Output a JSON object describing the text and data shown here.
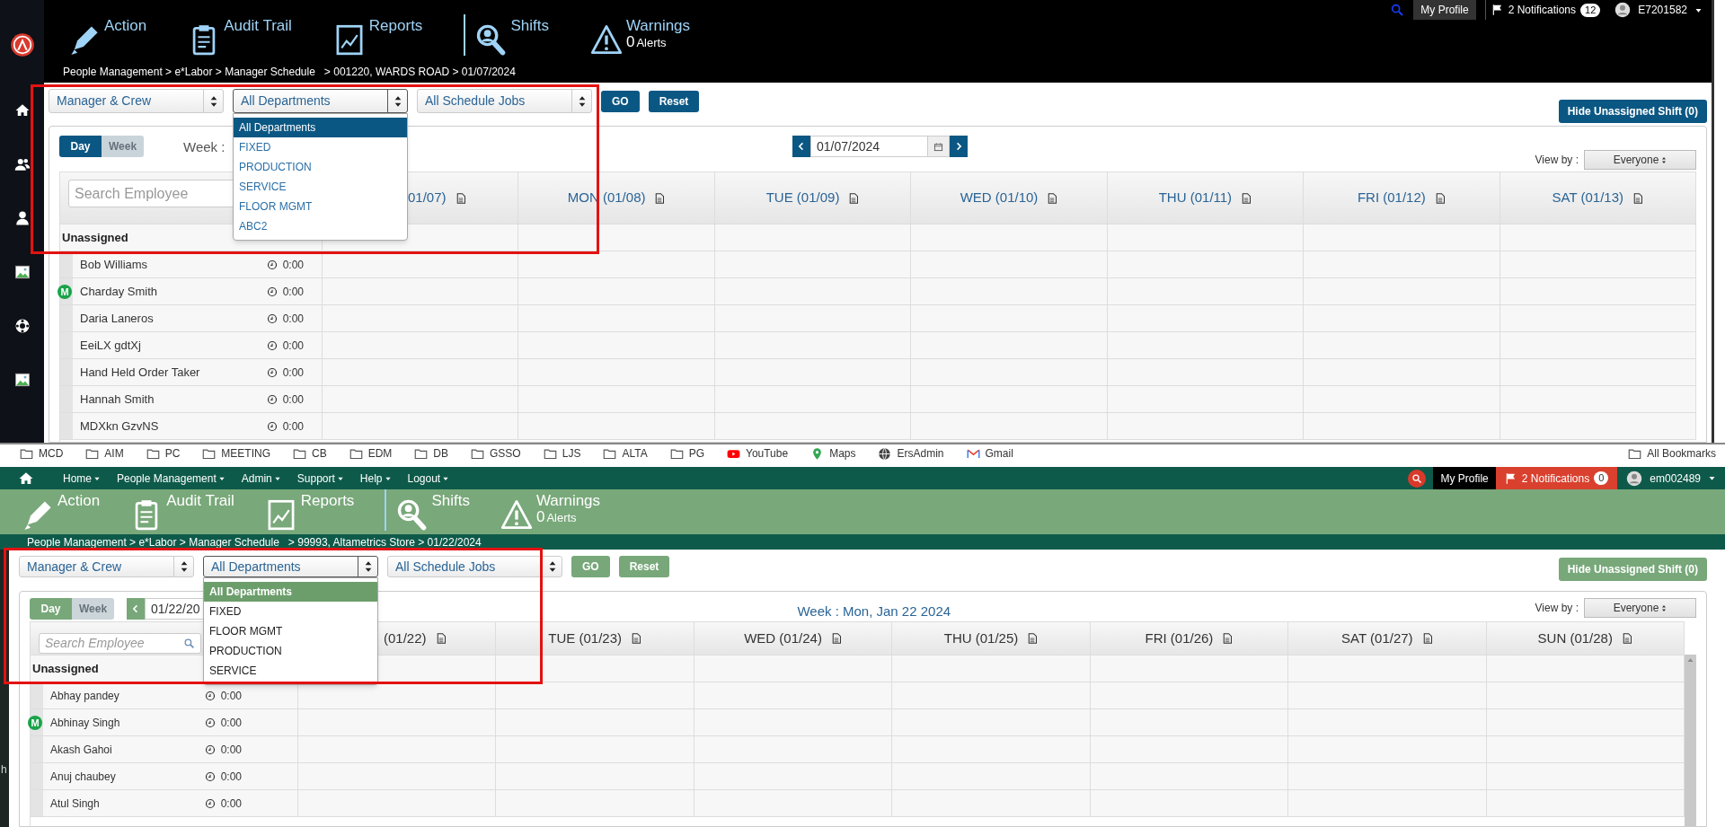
{
  "top_window": {
    "kind": "dark",
    "sidebar": [
      {
        "kind": "logo"
      },
      {
        "kind": "home"
      },
      {
        "kind": "users"
      },
      {
        "kind": "user"
      },
      {
        "kind": "image"
      },
      {
        "kind": "lifebuoy"
      },
      {
        "kind": "image"
      }
    ],
    "account": {
      "profile": "My Profile",
      "notifications": "2 Notifications",
      "notification_count": "12",
      "user": "E7201582"
    },
    "toolbar": [
      {
        "kind": "pencil",
        "label": "Action"
      },
      {
        "kind": "clipboard",
        "label": "Audit Trail"
      },
      {
        "kind": "report",
        "label": "Reports"
      },
      {
        "kind": "search-person",
        "label": "Shifts",
        "divider": true
      },
      {
        "kind": "warning",
        "label": "Warnings",
        "count": "0",
        "count_label": "Alerts"
      }
    ],
    "breadcrumb": "People Management > e*Labor > Manager Schedule   > 001220, WARDS ROAD > 01/07/2024",
    "filters": [
      {
        "value": "Manager & Crew",
        "expanded": false
      },
      {
        "value": "All Departments",
        "expanded": true,
        "options": [
          {
            "label": "All Departments",
            "selected": true
          },
          {
            "label": "FIXED",
            "selected": false
          },
          {
            "label": "PRODUCTION",
            "selected": false
          },
          {
            "label": "SERVICE",
            "selected": false
          },
          {
            "label": "FLOOR MGMT",
            "selected": false
          },
          {
            "label": "ABC2",
            "selected": false
          }
        ]
      },
      {
        "value": "All Schedule Jobs",
        "expanded": false
      }
    ],
    "actions": [
      "GO",
      "Reset"
    ],
    "hide_button": "Hide Unassigned Shift (0)",
    "view_modes": [
      {
        "label": "Day",
        "selected": true
      },
      {
        "label": "Week",
        "selected": false
      }
    ],
    "week_label": "Week :",
    "date_nav": {
      "kind": "center",
      "value": "01/07/2024"
    },
    "view_by": {
      "label": "View by :",
      "value": "Everyone"
    },
    "search_placeholder": "Search Employee",
    "days": [
      "01/07)",
      "MON (01/08)",
      "TUE (01/09)",
      "WED (01/10)",
      "THU (01/11)",
      "FRI (01/12)",
      "SAT (01/13)"
    ],
    "unassigned": "Unassigned",
    "employees": [
      {
        "name": "Bob Williams",
        "hours": "0:00"
      },
      {
        "name": "Charday Smith",
        "hours": "0:00",
        "badge": "M"
      },
      {
        "name": "Daria Laneros",
        "hours": "0:00"
      },
      {
        "name": "EeiLX gdtXj",
        "hours": "0:00"
      },
      {
        "name": "Hand Held Order Taker",
        "hours": "0:00"
      },
      {
        "name": "Hannah Smith",
        "hours": "0:00"
      },
      {
        "name": "MDXkn GzvNS",
        "hours": "0:00"
      }
    ]
  },
  "bottom_window": {
    "kind": "green",
    "bookmarks": [
      {
        "kind": "folder",
        "label": "MCD"
      },
      {
        "kind": "folder",
        "label": "AIM"
      },
      {
        "kind": "folder",
        "label": "PC"
      },
      {
        "kind": "folder",
        "label": "MEETING"
      },
      {
        "kind": "folder",
        "label": "CB"
      },
      {
        "kind": "folder",
        "label": "EDM"
      },
      {
        "kind": "folder",
        "label": "DB"
      },
      {
        "kind": "folder",
        "label": "GSSO"
      },
      {
        "kind": "folder",
        "label": "LJS"
      },
      {
        "kind": "folder",
        "label": "ALTA"
      },
      {
        "kind": "folder",
        "label": "PG"
      },
      {
        "kind": "video",
        "label": "YouTube"
      },
      {
        "kind": "pin",
        "label": "Maps"
      },
      {
        "kind": "globe",
        "label": "ErsAdmin"
      },
      {
        "kind": "mail",
        "label": "Gmail"
      }
    ],
    "all_bookmarks": "All Bookmarks",
    "menu": [
      "Home",
      "People Management",
      "Admin",
      "Support",
      "Help",
      "Logout"
    ],
    "account": {
      "profile": "My Profile",
      "notifications": "2 Notifications",
      "notification_count": "0",
      "user": "em002489"
    },
    "toolbar": [
      {
        "kind": "pencil",
        "label": "Action"
      },
      {
        "kind": "clipboard",
        "label": "Audit Trail"
      },
      {
        "kind": "report",
        "label": "Reports"
      },
      {
        "kind": "search-person",
        "label": "Shifts",
        "divider": true
      },
      {
        "kind": "warning",
        "label": "Warnings",
        "count": "0",
        "count_label": "Alerts"
      }
    ],
    "breadcrumb": "People Management > e*Labor > Manager Schedule   > 99993, Altametrics Store > 01/22/2024",
    "filters": [
      {
        "value": "Manager & Crew",
        "expanded": false
      },
      {
        "value": "All Departments",
        "expanded": true,
        "options": [
          {
            "label": "All Departments",
            "selected": true
          },
          {
            "label": "FIXED",
            "selected": false
          },
          {
            "label": "FLOOR MGMT",
            "selected": false
          },
          {
            "label": "PRODUCTION",
            "selected": false
          },
          {
            "label": "SERVICE",
            "selected": false
          }
        ]
      },
      {
        "value": "All Schedule Jobs",
        "expanded": false
      }
    ],
    "actions": [
      "GO",
      "Reset"
    ],
    "hide_button": "Hide Unassigned Shift (0)",
    "view_modes": [
      {
        "label": "Day",
        "selected": true
      },
      {
        "label": "Week",
        "selected": false
      }
    ],
    "week_label": "Week : Mon, Jan 22 2024",
    "date_nav": {
      "kind": "left",
      "value": "01/22/20"
    },
    "view_by": {
      "label": "View by :",
      "value": "Everyone"
    },
    "search_placeholder": "Search Employee",
    "days": [
      "(01/22)",
      "TUE (01/23)",
      "WED (01/24)",
      "THU (01/25)",
      "FRI (01/26)",
      "SAT (01/27)",
      "SUN (01/28)"
    ],
    "unassigned": "Unassigned",
    "employees": [
      {
        "name": "Abhay pandey",
        "hours": "0:00"
      },
      {
        "name": "Abhinay Singh",
        "hours": "0:00",
        "badge": "M"
      },
      {
        "name": "Akash Gahoi",
        "hours": "0:00"
      },
      {
        "name": "Anuj chaubey",
        "hours": "0:00"
      },
      {
        "name": "Atul Singh",
        "hours": "0:00"
      }
    ],
    "behind_window_text": "h"
  }
}
